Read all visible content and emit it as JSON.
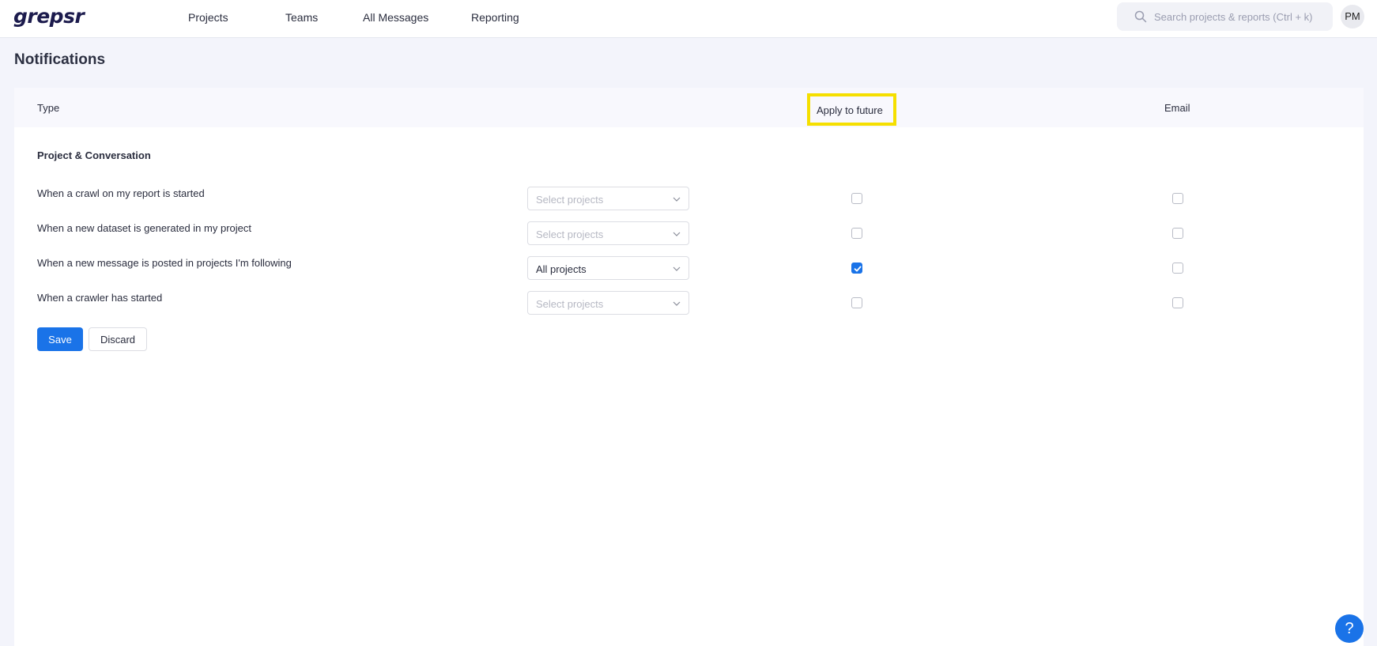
{
  "brand": {
    "logo_text": "grepsr"
  },
  "nav": {
    "items": [
      {
        "label": "Projects"
      },
      {
        "label": "Teams"
      },
      {
        "label": "All Messages"
      },
      {
        "label": "Reporting"
      }
    ]
  },
  "search": {
    "placeholder": "Search projects & reports (Ctrl + k)",
    "icon": "search-icon"
  },
  "user": {
    "initials": "PM"
  },
  "page": {
    "title": "Notifications"
  },
  "table": {
    "columns": {
      "type": "Type",
      "apply": "Apply to future",
      "email": "Email"
    },
    "section_title": "Project & Conversation",
    "rows": [
      {
        "label": "When a crawl on my report is started",
        "select_value": "Select projects",
        "apply_checked": false,
        "email_checked": false
      },
      {
        "label": "When a new dataset is generated in my project",
        "select_value": "Select projects",
        "apply_checked": false,
        "email_checked": false
      },
      {
        "label": "When a new message is posted in projects I'm following",
        "select_value": "All projects",
        "apply_checked": true,
        "email_checked": false
      },
      {
        "label": "When a crawler has started",
        "select_value": "Select projects",
        "apply_checked": false,
        "email_checked": false
      }
    ]
  },
  "actions": {
    "save_label": "Save",
    "discard_label": "Discard"
  },
  "help": {
    "label": "?"
  },
  "colors": {
    "accent": "#1a73e8",
    "highlight": "#f5df00",
    "background": "#f3f4fb"
  }
}
